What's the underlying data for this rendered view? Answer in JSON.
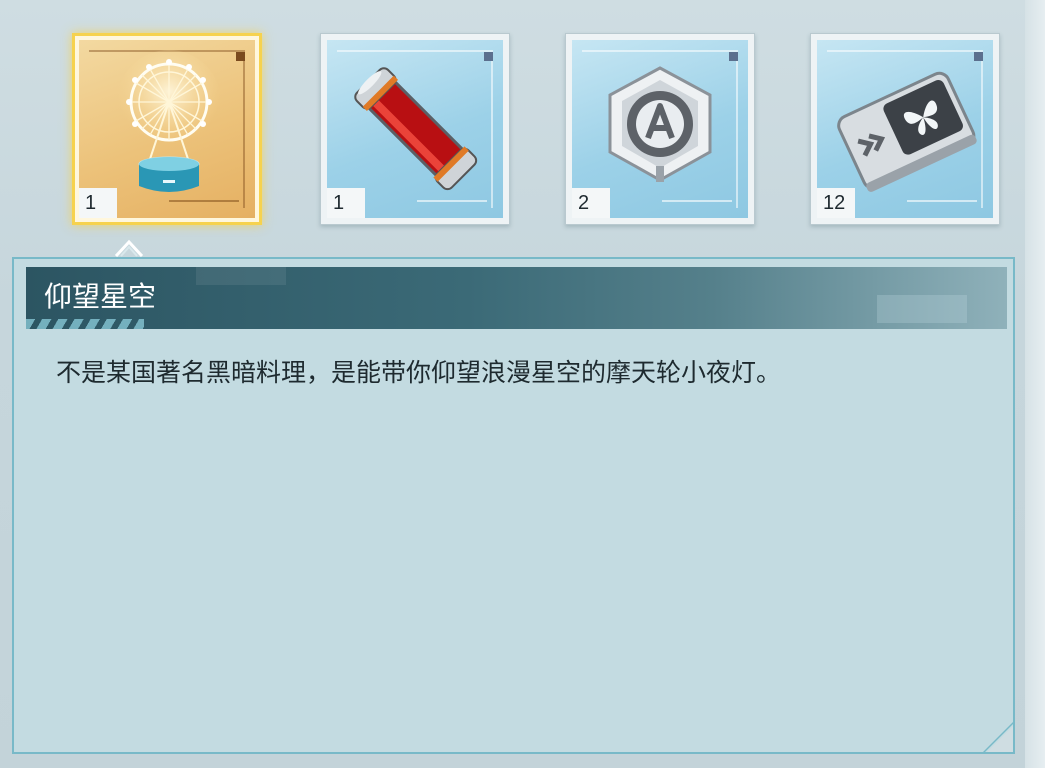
{
  "items": [
    {
      "name": "ferris-wheel-night-light",
      "icon": "ferris-wheel-icon",
      "count": "1",
      "selected": true,
      "rarity_color": "#ecc27a"
    },
    {
      "name": "red-vial",
      "icon": "red-vial-icon",
      "count": "1",
      "selected": false,
      "rarity_color": "#9cd1e8"
    },
    {
      "name": "hex-badge",
      "icon": "hex-badge-icon",
      "count": "2",
      "selected": false,
      "rarity_color": "#9cd1e8"
    },
    {
      "name": "butterfly-chip",
      "icon": "butterfly-chip-icon",
      "count": "12",
      "selected": false,
      "rarity_color": "#9cd1e8"
    }
  ],
  "detail": {
    "title": "仰望星空",
    "description": "不是某国著名黑暗料理，是能带你仰望浪漫星空的摩天轮小夜灯。"
  },
  "colors": {
    "selection": "#f6d24e",
    "panel": "#c3dbe1",
    "title_bar": "#2c5562"
  }
}
